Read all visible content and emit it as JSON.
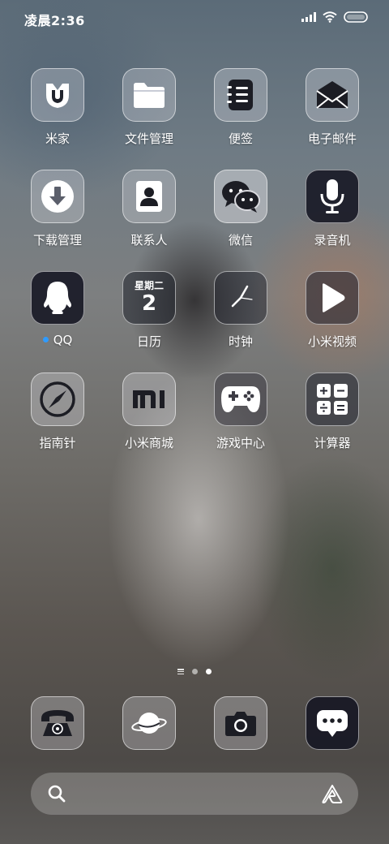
{
  "status_bar": {
    "time": "凌晨2:36"
  },
  "apps": [
    {
      "label": "米家",
      "icon": "mijia-icon"
    },
    {
      "label": "文件管理",
      "icon": "folder-icon"
    },
    {
      "label": "便签",
      "icon": "notes-icon"
    },
    {
      "label": "电子邮件",
      "icon": "mail-icon"
    },
    {
      "label": "下载管理",
      "icon": "download-icon"
    },
    {
      "label": "联系人",
      "icon": "contacts-icon"
    },
    {
      "label": "微信",
      "icon": "wechat-icon"
    },
    {
      "label": "录音机",
      "icon": "microphone-icon"
    },
    {
      "label": "QQ",
      "icon": "qq-penguin-icon",
      "has_new_dot": true
    },
    {
      "label": "日历",
      "icon": "calendar-icon",
      "calendar_weekday": "星期二",
      "calendar_day": "2"
    },
    {
      "label": "时钟",
      "icon": "clock-icon"
    },
    {
      "label": "小米视频",
      "icon": "play-icon"
    },
    {
      "label": "指南针",
      "icon": "compass-icon"
    },
    {
      "label": "小米商城",
      "icon": "mi-logo-icon"
    },
    {
      "label": "游戏中心",
      "icon": "gamepad-icon"
    },
    {
      "label": "计算器",
      "icon": "calculator-icon"
    }
  ],
  "dock": [
    {
      "icon": "phone-icon"
    },
    {
      "icon": "browser-planet-icon"
    },
    {
      "icon": "camera-icon"
    },
    {
      "icon": "message-icon"
    }
  ],
  "page_indicator": {
    "pages": 2,
    "active_page": 2
  },
  "colors": {
    "notification_dot": "#2f9bff",
    "label_text": "#ffffff"
  }
}
